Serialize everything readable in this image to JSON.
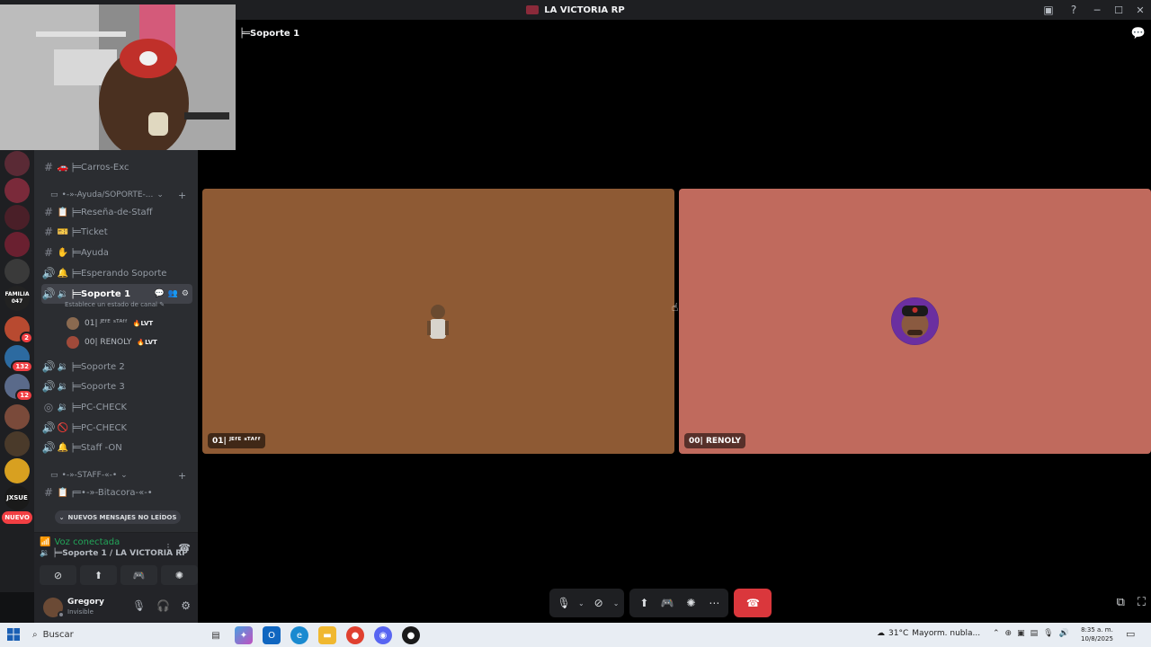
{
  "window": {
    "title": "LA VICTORIA RP"
  },
  "guild_badges": {
    "g1": "2",
    "g2": "132",
    "g3": "12",
    "nuevo": "NUEVO"
  },
  "guild_labels": {
    "familia": "FAMILIA\n047",
    "jxsue": "JXSUE"
  },
  "sidebar": {
    "partial_top": "Carros-Exc",
    "channels": [
      {
        "name": "╞═Carros-Exc"
      },
      {
        "name": "╞═Reseña-de-Staff"
      },
      {
        "name": "╞═Ticket"
      },
      {
        "name": "╞═Ayuda"
      },
      {
        "name": "╞═Esperando Soporte"
      },
      {
        "name": "╞═Soporte 1"
      },
      {
        "name": "╞═Soporte 2"
      },
      {
        "name": "╞═Soporte 3"
      },
      {
        "name": "╞═PC-CHECK"
      },
      {
        "name": "╞═PC-CHECK"
      },
      {
        "name": "╞═Staff -ON"
      },
      {
        "name": "╒═•-»-Bitacora-«-•"
      }
    ],
    "category_ayuda": "•-»-Ayuda/SOPORTE-...",
    "category_staff": "•-»-STAFF-«-•",
    "status_hint": "Establece un estado de canal",
    "voice_users": [
      {
        "name": "01| ᴶᴱᶠᴱ ˢᵀᴬᶠᶠ",
        "tag": "LVT"
      },
      {
        "name": "00| RENOLY",
        "tag": "LVT"
      }
    ],
    "new_messages": "NUEVOS MENSAJES NO LEÍDOS"
  },
  "voice_panel": {
    "status": "Voz conectada",
    "channel": "╞═Soporte 1 / LA VICTORIA RP"
  },
  "user": {
    "name": "Gregory",
    "status": "Invisible"
  },
  "stage": {
    "title": "╞═Soporte 1",
    "tiles": [
      {
        "label": "01| ᴶᴱᶠᴱ ˢᵀᴬᶠᶠ",
        "color": "#8e5a34"
      },
      {
        "label": "00| RENOLY",
        "color": "#c06a5d"
      }
    ]
  },
  "taskbar": {
    "search": "Buscar",
    "temp": "31°C",
    "weather": "Mayorm. nubla...",
    "time": "8:35 a. m.",
    "date": "10/8/2025"
  },
  "colors": {
    "accent_green": "#23a559",
    "hangup": "#da373c",
    "badge": "#f23f43"
  }
}
